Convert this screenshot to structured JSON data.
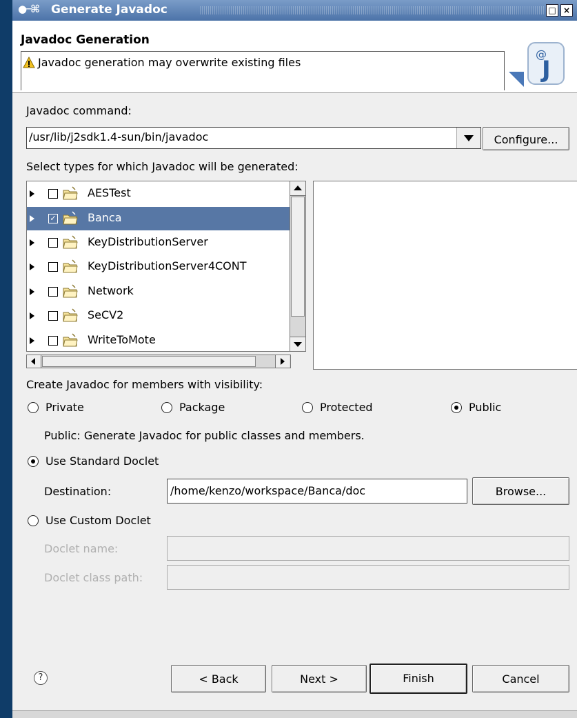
{
  "window": {
    "title": "Generate Javadoc",
    "buttons": [
      "maximize-icon",
      "close-icon"
    ]
  },
  "banner": {
    "title": "Javadoc Generation",
    "message": "Javadoc generation may overwrite existing files",
    "icons": [
      "warning-icon",
      "javadoc-wizard-icon"
    ]
  },
  "command": {
    "label": "Javadoc command:",
    "value": "/usr/lib/j2sdk1.4-sun/bin/javadoc",
    "configure_label": "Configure..."
  },
  "types": {
    "label": "Select types for which Javadoc will be generated:",
    "items": [
      {
        "name": "AESTest",
        "checked": false,
        "selected": false
      },
      {
        "name": "Banca",
        "checked": true,
        "selected": true
      },
      {
        "name": "KeyDistributionServer",
        "checked": false,
        "selected": false
      },
      {
        "name": "KeyDistributionServer4CONT",
        "checked": false,
        "selected": false
      },
      {
        "name": "Network",
        "checked": false,
        "selected": false
      },
      {
        "name": "SeCV2",
        "checked": false,
        "selected": false
      },
      {
        "name": "WriteToMote",
        "checked": false,
        "selected": false
      }
    ]
  },
  "visibility": {
    "label": "Create Javadoc for members with visibility:",
    "options": [
      "Private",
      "Package",
      "Protected",
      "Public"
    ],
    "selected": "Public",
    "description": "Public: Generate Javadoc for public classes and members."
  },
  "standard_doclet": {
    "label": "Use Standard Doclet",
    "selected": true,
    "destination_label": "Destination:",
    "destination_value": "/home/kenzo/workspace/Banca/doc",
    "browse_label": "Browse..."
  },
  "custom_doclet": {
    "label": "Use Custom Doclet",
    "selected": false,
    "name_label": "Doclet name:",
    "classpath_label": "Doclet class path:"
  },
  "footer": {
    "back_label": "< Back",
    "next_label": "Next >",
    "finish_label": "Finish",
    "cancel_label": "Cancel",
    "help_icon": "help-icon"
  },
  "colors": {
    "desktop": "#0f3c68",
    "titlebar": "#5a80b4",
    "selection": "#5777a5",
    "dialog": "#efefef"
  }
}
